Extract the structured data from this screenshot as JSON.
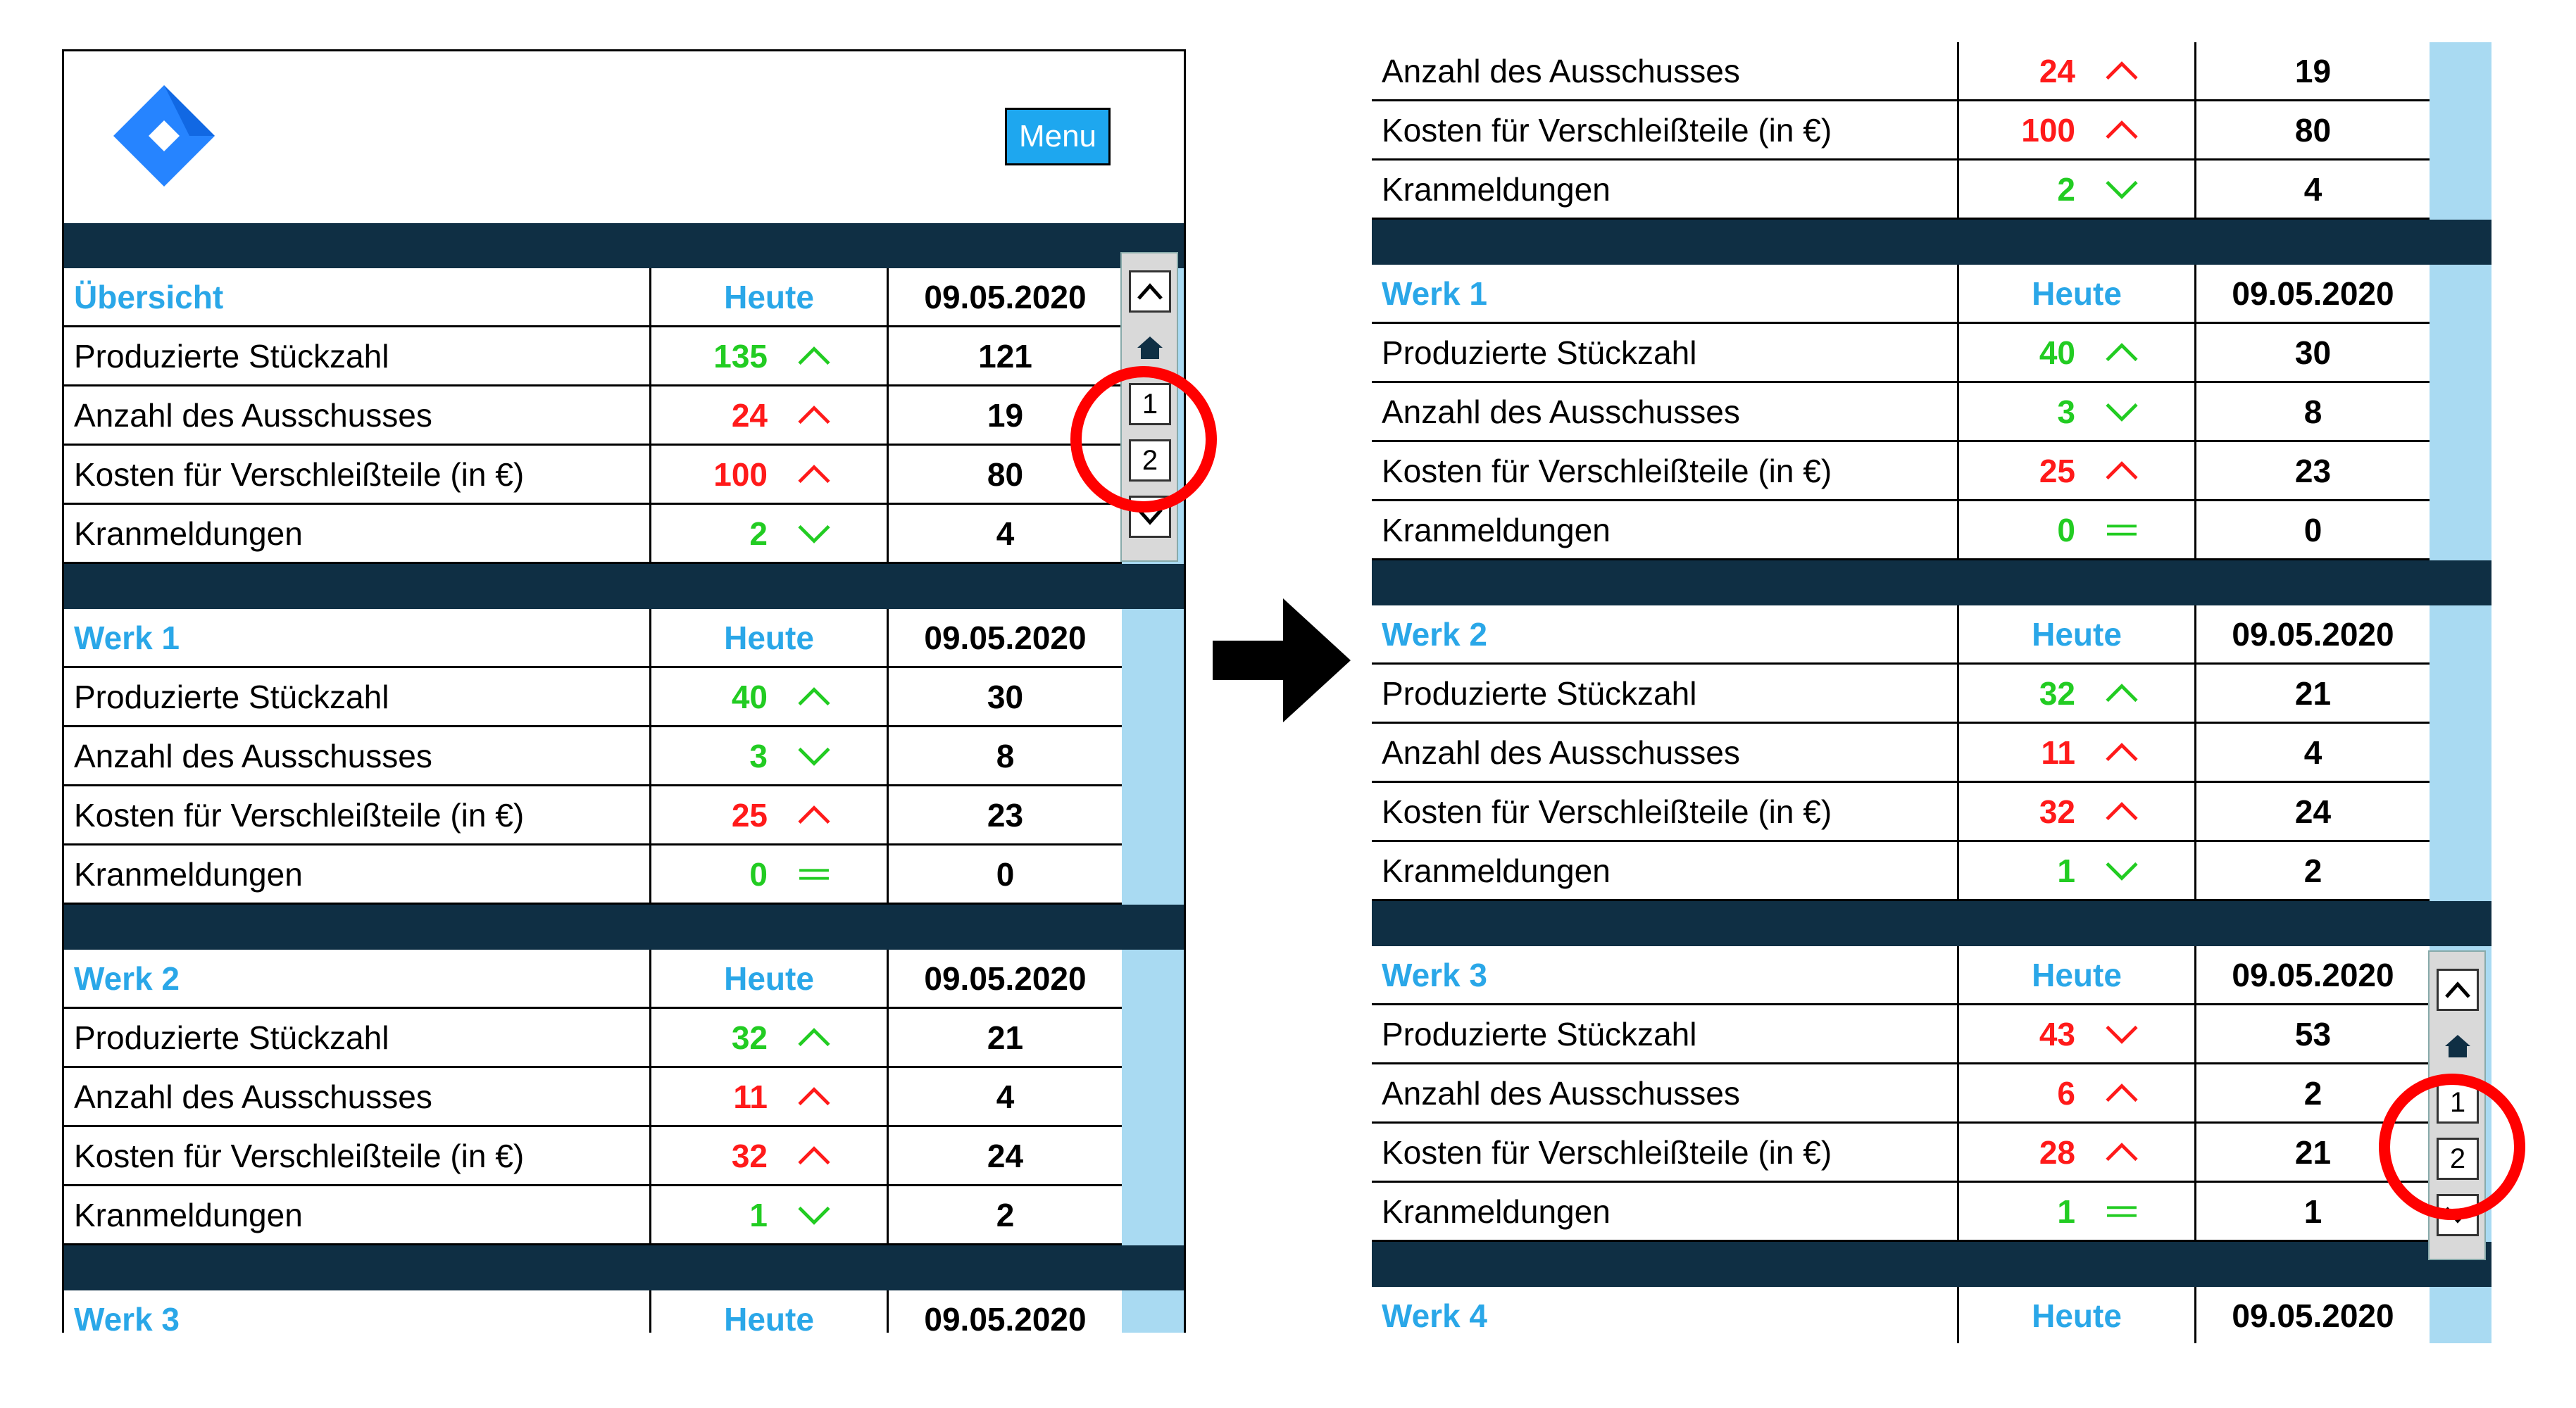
{
  "menu_label": "Menu",
  "header_today": "Heute",
  "header_date": "09.05.2020",
  "nav": {
    "page1": "1",
    "page2": "2"
  },
  "sections": {
    "overview": {
      "title": "Übersicht",
      "rows": [
        {
          "label": "Produzierte Stückzahl",
          "today": "135",
          "prev": "121",
          "trend": "up",
          "color": "green"
        },
        {
          "label": "Anzahl des Ausschusses",
          "today": "24",
          "prev": "19",
          "trend": "up",
          "color": "red"
        },
        {
          "label": "Kosten für Verschleißteile (in €)",
          "today": "100",
          "prev": "80",
          "trend": "up",
          "color": "red"
        },
        {
          "label": "Kranmeldungen",
          "today": "2",
          "prev": "4",
          "trend": "down",
          "color": "green"
        }
      ]
    },
    "werk1": {
      "title": "Werk 1",
      "rows": [
        {
          "label": "Produzierte Stückzahl",
          "today": "40",
          "prev": "30",
          "trend": "up",
          "color": "green"
        },
        {
          "label": "Anzahl des Ausschusses",
          "today": "3",
          "prev": "8",
          "trend": "down",
          "color": "green"
        },
        {
          "label": "Kosten für Verschleißteile (in €)",
          "today": "25",
          "prev": "23",
          "trend": "up",
          "color": "red"
        },
        {
          "label": "Kranmeldungen",
          "today": "0",
          "prev": "0",
          "trend": "equal",
          "color": "green"
        }
      ]
    },
    "werk2": {
      "title": "Werk 2",
      "rows": [
        {
          "label": "Produzierte Stückzahl",
          "today": "32",
          "prev": "21",
          "trend": "up",
          "color": "green"
        },
        {
          "label": "Anzahl des Ausschusses",
          "today": "11",
          "prev": "4",
          "trend": "up",
          "color": "red"
        },
        {
          "label": "Kosten für Verschleißteile (in €)",
          "today": "32",
          "prev": "24",
          "trend": "up",
          "color": "red"
        },
        {
          "label": "Kranmeldungen",
          "today": "1",
          "prev": "2",
          "trend": "down",
          "color": "green"
        }
      ]
    },
    "werk3": {
      "title": "Werk 3",
      "rows": [
        {
          "label": "Produzierte Stückzahl",
          "today": "43",
          "prev": "53",
          "trend": "down",
          "color": "red"
        },
        {
          "label": "Anzahl des Ausschusses",
          "today": "6",
          "prev": "2",
          "trend": "up",
          "color": "red"
        },
        {
          "label": "Kosten für Verschleißteile (in €)",
          "today": "28",
          "prev": "21",
          "trend": "up",
          "color": "red"
        },
        {
          "label": "Kranmeldungen",
          "today": "1",
          "prev": "1",
          "trend": "equal",
          "color": "green"
        }
      ]
    },
    "werk4": {
      "title": "Werk 4"
    }
  }
}
